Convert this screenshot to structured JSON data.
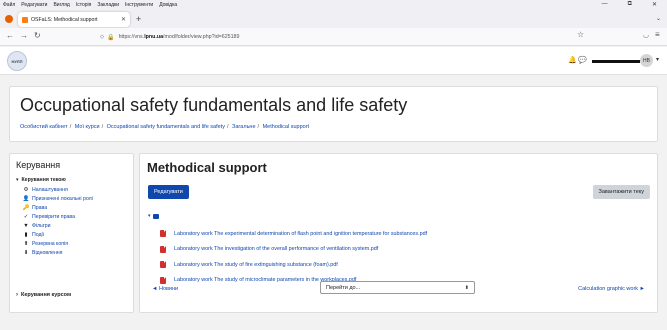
{
  "browser": {
    "menu": [
      "Файл",
      "Редагувати",
      "Вигляд",
      "Історія",
      "Закладки",
      "Інструменти",
      "Довідка"
    ],
    "tab_title": "OSFaLS: Methodical support",
    "url_prefix": "https://vns.",
    "url_domain": "lpnu.ua",
    "url_path": "/mod/folder/view.php?id=625189"
  },
  "header": {
    "logo_text": "НУЛП",
    "avatar_initials": "HB"
  },
  "course": {
    "title": "Occupational safety fundamentals and life safety",
    "breadcrumb": [
      "Особистий кабінет",
      "Мої курси",
      "Occupational safety fundamentals and life safety",
      "Загальне",
      "Methodical support"
    ]
  },
  "admin": {
    "title": "Керування",
    "group_label": "Керування текою",
    "items": [
      {
        "label": "Налаштування",
        "icon": "gear-icon",
        "glyph": "⚙"
      },
      {
        "label": "Призначені локальні ролі",
        "icon": "users-icon",
        "glyph": "👤"
      },
      {
        "label": "Права",
        "icon": "key-icon",
        "glyph": "🔑"
      },
      {
        "label": "Перевірити права",
        "icon": "check-icon",
        "glyph": "✓"
      },
      {
        "label": "Фільтри",
        "icon": "filter-icon",
        "glyph": "▼"
      },
      {
        "label": "Події",
        "icon": "chart-icon",
        "glyph": "▮"
      },
      {
        "label": "Резервна копія",
        "icon": "backup-icon",
        "glyph": "⬆"
      },
      {
        "label": "Відновлення",
        "icon": "restore-icon",
        "glyph": "⬇"
      }
    ],
    "course_admin_label": "Керування курсом"
  },
  "main": {
    "title": "Methodical support",
    "edit_label": "Редагувати",
    "download_label": "Завантажити теку",
    "files": [
      "Laboratory work The experimental determination of flash point and ignition temperature for substances.pdf",
      "Laboratory work The investigation of the overall performance of ventilation system.pdf",
      "Laboratory work The study of fire extinguishing substance (foam).pdf",
      "Laboratory work The study of microclimate parameters in the workplaces.pdf"
    ],
    "prev_link": "◄ Новини",
    "jump_label": "Перейти до...",
    "next_link": "Calculation graphic work ►"
  },
  "colors": {
    "link": "#0f47ad",
    "primary_button": "#0f47ad",
    "pdf": "#d32f2f"
  }
}
